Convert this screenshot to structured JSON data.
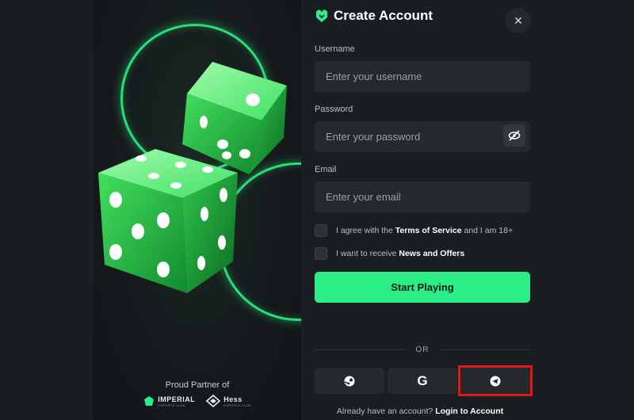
{
  "header": {
    "title": "Create Account",
    "logo_icon": "shield-logo-icon",
    "close_icon": "close-icon",
    "close_glyph": "✕"
  },
  "fields": {
    "username": {
      "label": "Username",
      "placeholder": "Enter your username",
      "value": ""
    },
    "password": {
      "label": "Password",
      "placeholder": "Enter your password",
      "value": "",
      "toggle_icon": "eye-off-icon"
    },
    "email": {
      "label": "Email",
      "placeholder": "Enter your email",
      "value": ""
    }
  },
  "checkboxes": {
    "terms": {
      "prefix": "I agree with the ",
      "link": "Terms of Service",
      "suffix": " and I am 18+",
      "checked": false
    },
    "news": {
      "prefix": "I want to receive ",
      "link": "News and Offers",
      "checked": false
    }
  },
  "start_button": {
    "label": "Start Playing"
  },
  "divider": {
    "text": "OR"
  },
  "social": [
    {
      "name": "steam",
      "icon": "steam-icon"
    },
    {
      "name": "google",
      "icon": "google-icon",
      "glyph": "G"
    },
    {
      "name": "telegram",
      "icon": "telegram-icon",
      "highlighted": true
    }
  ],
  "footer": {
    "text": "Already have an account? ",
    "link": "Login to Account"
  },
  "promo": {
    "partner_text": "Proud Partner of",
    "partners": [
      {
        "name": "IMPERIAL",
        "subtitle": "ESPORTS CLUB",
        "icon": "imperial-logo"
      },
      {
        "name": "Hess",
        "subtitle": "ESPORTS CLUB",
        "icon": "hess-logo"
      }
    ],
    "art": "green-dice-illustration"
  },
  "colors": {
    "accent": "#2bef86",
    "background": "#1a1d21",
    "input": "#25292e",
    "highlight": "#e01818"
  }
}
